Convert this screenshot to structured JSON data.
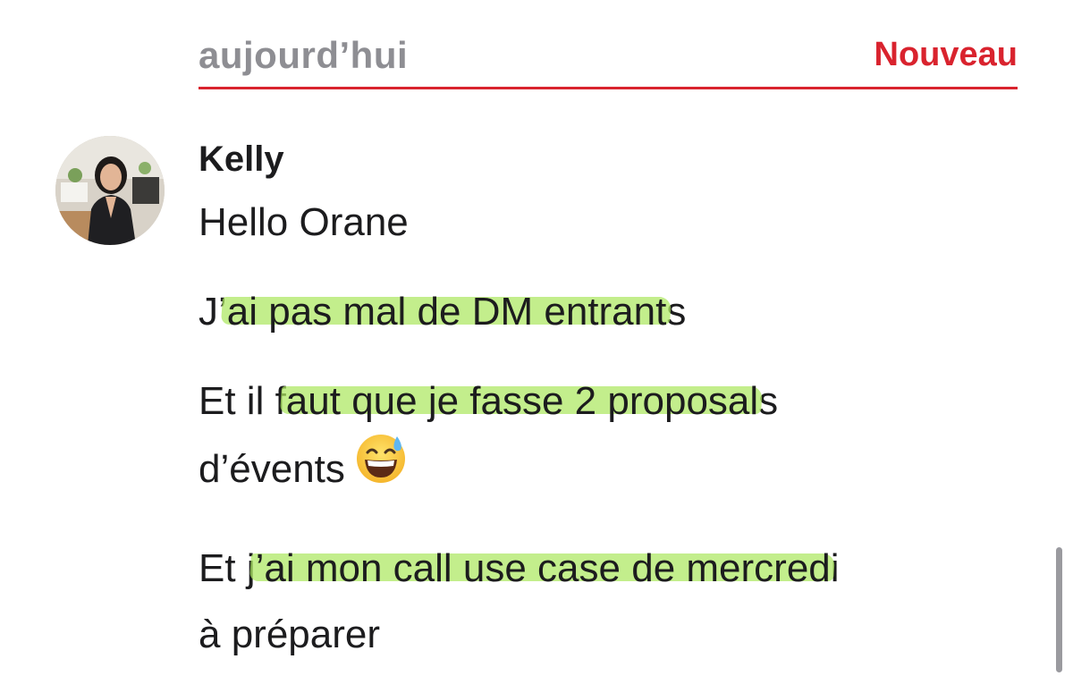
{
  "header": {
    "day_label": "aujourd’hui",
    "new_label": "Nouveau"
  },
  "message": {
    "sender": "Kelly",
    "avatar_icon": "user-avatar",
    "lines": {
      "greeting": "Hello Orane",
      "dm_prefix": "J’",
      "dm_highlight": "ai pas mal de DM entrant",
      "dm_suffix": "s",
      "proposal_prefix": "Et il f",
      "proposal_highlight": "aut que je fasse 2 proposal",
      "proposal_suffix": "s",
      "events": "d’évents",
      "events_emoji": "grinning-face-with-sweat-icon",
      "call_prefix": "Et j",
      "call_highlight": "’ai mon call use case de mercred",
      "call_suffix": "i",
      "prepare": "à préparer"
    }
  },
  "colors": {
    "accent_red": "#d9232e",
    "muted_gray": "#8e8e93",
    "highlight_green": "#ace860"
  }
}
